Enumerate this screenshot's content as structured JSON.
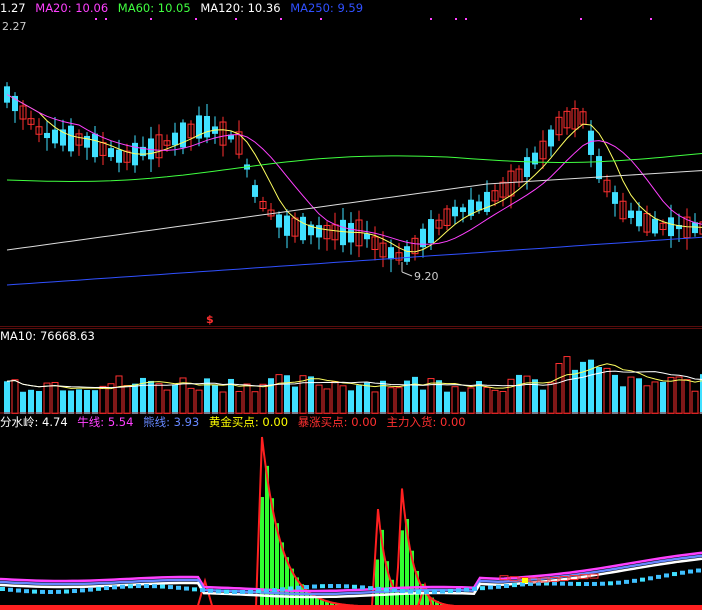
{
  "price_panel": {
    "legend": [
      {
        "id": "ma10",
        "text": "1.27",
        "color": "#ffffff"
      },
      {
        "id": "ma20",
        "text": "MA20: 10.06",
        "color": "#ff40ff"
      },
      {
        "id": "ma60",
        "text": "MA60: 10.05",
        "color": "#40ff40"
      },
      {
        "id": "ma120",
        "text": "MA120: 10.36",
        "color": "#ffffff"
      },
      {
        "id": "ma250",
        "text": "MA250: 9.59",
        "color": "#3050ff"
      }
    ],
    "top_value": "2.27",
    "low_label": "9.20",
    "signal_glyph": "$",
    "up_color": "#ff3030",
    "down_color": "#40e0ff"
  },
  "volume_panel": {
    "legend": "MA10: 76668.63",
    "legend_color": "#ffffff"
  },
  "indicator_panel": {
    "legend": [
      {
        "id": "fsl",
        "text": "分水岭: 4.74",
        "color": "#ffffff"
      },
      {
        "id": "nx",
        "text": "牛线: 5.54",
        "color": "#ff40ff"
      },
      {
        "id": "xx",
        "text": "熊线: 3.93",
        "color": "#6688ff"
      },
      {
        "id": "hj",
        "text": "黄金买点: 0.00",
        "color": "#ffff00"
      },
      {
        "id": "bz",
        "text": "暴涨买点: 0.00",
        "color": "#ff3030"
      },
      {
        "id": "zl",
        "text": "主力入货: 0.00",
        "color": "#ff3030"
      }
    ]
  },
  "chart_data": [
    {
      "type": "candlestick",
      "title": "",
      "series": [
        {
          "name": "MA20"
        },
        {
          "name": "MA60"
        },
        {
          "name": "MA120"
        },
        {
          "name": "MA250"
        }
      ],
      "ylim": [
        8.9,
        12.3
      ],
      "annotations": [
        "9.20"
      ]
    },
    {
      "type": "bar",
      "title": "",
      "series": [
        {
          "name": "MA10"
        }
      ]
    },
    {
      "type": "area",
      "title": "",
      "series": [
        {
          "name": "分水岭"
        },
        {
          "name": "牛线"
        },
        {
          "name": "熊线"
        },
        {
          "name": "黄金买点"
        },
        {
          "name": "暴涨买点"
        },
        {
          "name": "主力入货"
        }
      ]
    }
  ]
}
